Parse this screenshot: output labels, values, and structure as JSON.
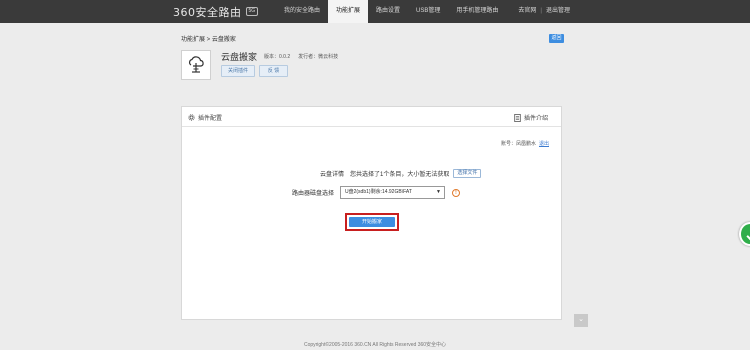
{
  "header": {
    "logo_text": "360安全路由",
    "logo_badge": "5G",
    "nav": [
      {
        "label": "我的安全路由",
        "active": false
      },
      {
        "label": "功能扩展",
        "active": true
      },
      {
        "label": "路由设置",
        "active": false
      },
      {
        "label": "USB管理",
        "active": false
      },
      {
        "label": "用手机管理路由",
        "active": false
      }
    ],
    "links": {
      "official": "去官网",
      "separator": "|",
      "logout": "退出管理"
    }
  },
  "breadcrumb": "功能扩展 > 云盘搬家",
  "back_label": "返回",
  "plugin": {
    "title": "云盘搬家",
    "version": "版本：0.0.2",
    "vendor": "发行者：微云科技",
    "disable_label": "关闭插件",
    "feedback_label": "反 馈"
  },
  "panel": {
    "tab_label": "插件配置",
    "info_label": "插件介绍",
    "account_label": "账号：",
    "account_name": "凤凰鹏水",
    "logout_label": "退出",
    "cloud_label": "云盘详情",
    "cloud_value": "您共选择了1个条目，大小暂无法获取",
    "choose_label": "选择文件",
    "disk_label": "路由器磁盘选择",
    "disk_value": "U盘2(sdb1)剩余:14.92GB\\FAT",
    "info_mark": "!",
    "start_label": "开始搬家"
  },
  "scroll_top": "⌄",
  "footer": "Copyright©2005-2016 360.CN All Rights Reserved 360安全中心"
}
